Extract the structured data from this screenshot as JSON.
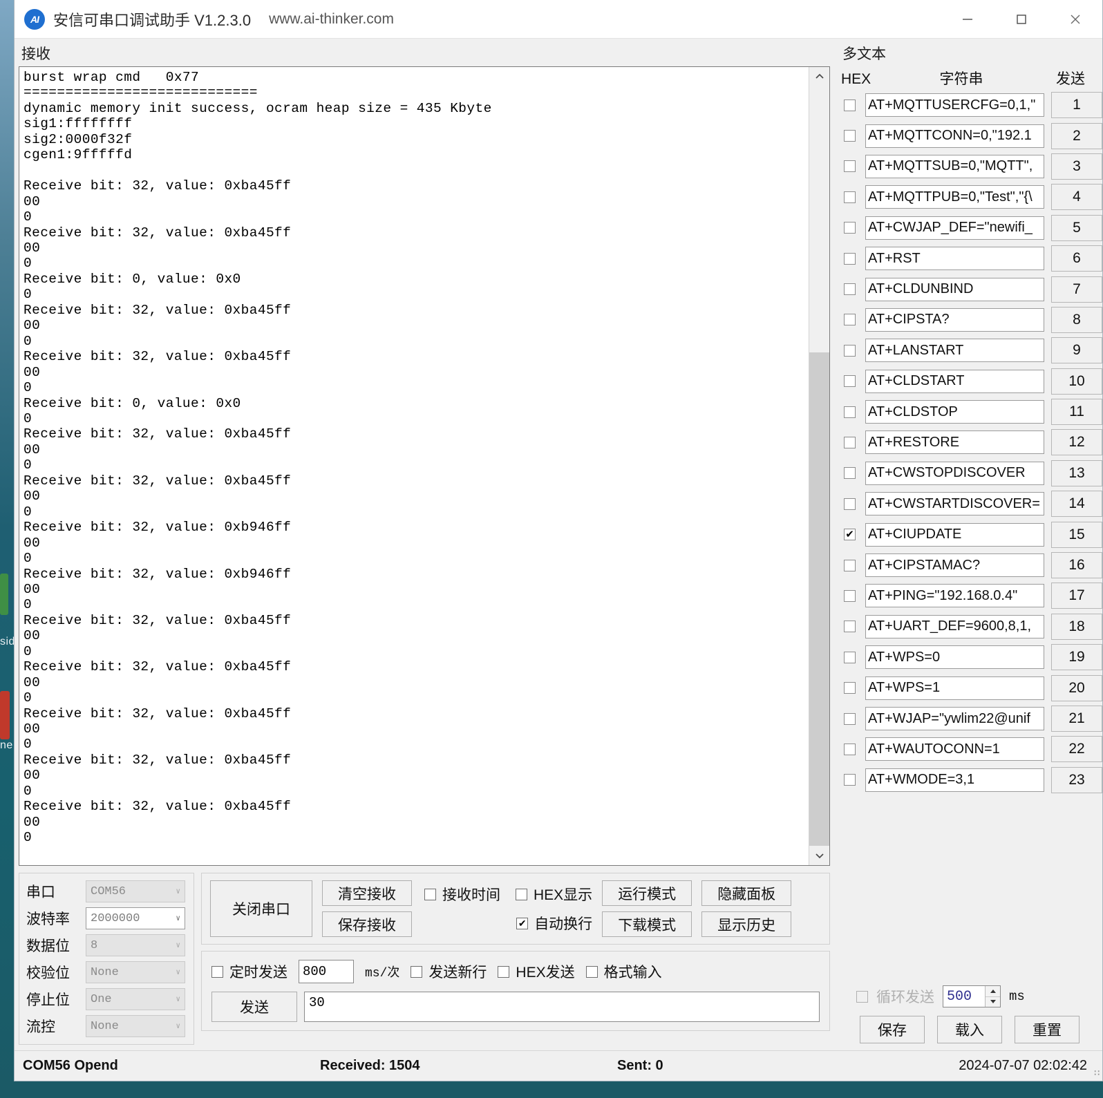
{
  "window": {
    "logo_text": "AI",
    "title": "安信可串口调试助手 V1.2.3.0",
    "url": "www.ai-thinker.com",
    "minimize": "—",
    "maximize": "☐",
    "close": "✕"
  },
  "receive": {
    "group_label": "接收",
    "text": "burst wrap cmd   0x77\n============================\ndynamic memory init success, ocram heap size = 435 Kbyte\nsig1:ffffffff\nsig2:0000f32f\ncgen1:9fffffd\n\nReceive bit: 32, value: 0xba45ff\n00\n0\nReceive bit: 32, value: 0xba45ff\n00\n0\nReceive bit: 0, value: 0x0\n0\nReceive bit: 32, value: 0xba45ff\n00\n0\nReceive bit: 32, value: 0xba45ff\n00\n0\nReceive bit: 0, value: 0x0\n0\nReceive bit: 32, value: 0xba45ff\n00\n0\nReceive bit: 32, value: 0xba45ff\n00\n0\nReceive bit: 32, value: 0xb946ff\n00\n0\nReceive bit: 32, value: 0xb946ff\n00\n0\nReceive bit: 32, value: 0xba45ff\n00\n0\nReceive bit: 32, value: 0xba45ff\n00\n0\nReceive bit: 32, value: 0xba45ff\n00\n0\nReceive bit: 32, value: 0xba45ff\n00\n0\nReceive bit: 32, value: 0xba45ff\n00\n0",
    "scroll_up": "▲",
    "scroll_down": "▼"
  },
  "serial_settings": {
    "rows": [
      {
        "label": "串口",
        "value": "COM56",
        "enabled": false
      },
      {
        "label": "波特率",
        "value": "2000000",
        "enabled": true
      },
      {
        "label": "数据位",
        "value": "8",
        "enabled": false
      },
      {
        "label": "校验位",
        "value": "None",
        "enabled": false
      },
      {
        "label": "停止位",
        "value": "One",
        "enabled": false
      },
      {
        "label": "流控",
        "value": "None",
        "enabled": false
      }
    ],
    "caret": "∨"
  },
  "controls": {
    "close_serial": "关闭串口",
    "clear_receive": "清空接收",
    "save_receive": "保存接收",
    "recv_time": {
      "label": "接收时间",
      "checked": false
    },
    "hex_display": {
      "label": "HEX显示",
      "checked": false
    },
    "auto_wrap": {
      "label": "自动换行",
      "checked": true
    },
    "run_mode": "运行模式",
    "download_mode": "下载模式",
    "hide_panel": "隐藏面板",
    "show_history": "显示历史",
    "check_mark": "✔"
  },
  "send_area": {
    "timed_send": {
      "label": "定时发送",
      "checked": false
    },
    "interval_value": "800",
    "interval_unit": "ms/次",
    "send_newline": {
      "label": "发送新行",
      "checked": false
    },
    "hex_send": {
      "label": "HEX发送",
      "checked": false
    },
    "format_input": {
      "label": "格式输入",
      "checked": false
    },
    "send_button": "发送",
    "send_text": "30"
  },
  "multitext": {
    "group_label": "多文本",
    "col_hex": "HEX",
    "col_string": "字符串",
    "col_send": "发送",
    "commands": [
      {
        "n": "1",
        "cmd": "AT+MQTTUSERCFG=0,1,\"",
        "checked": false
      },
      {
        "n": "2",
        "cmd": "AT+MQTTCONN=0,\"192.1",
        "checked": false
      },
      {
        "n": "3",
        "cmd": "AT+MQTTSUB=0,\"MQTT\",",
        "checked": false
      },
      {
        "n": "4",
        "cmd": "AT+MQTTPUB=0,\"Test\",\"{\\",
        "checked": false
      },
      {
        "n": "5",
        "cmd": "AT+CWJAP_DEF=\"newifi_",
        "checked": false
      },
      {
        "n": "6",
        "cmd": "AT+RST",
        "checked": false
      },
      {
        "n": "7",
        "cmd": "AT+CLDUNBIND",
        "checked": false
      },
      {
        "n": "8",
        "cmd": "AT+CIPSTA?",
        "checked": false
      },
      {
        "n": "9",
        "cmd": "AT+LANSTART",
        "checked": false
      },
      {
        "n": "10",
        "cmd": "AT+CLDSTART",
        "checked": false
      },
      {
        "n": "11",
        "cmd": "AT+CLDSTOP",
        "checked": false
      },
      {
        "n": "12",
        "cmd": "AT+RESTORE",
        "checked": false
      },
      {
        "n": "13",
        "cmd": "AT+CWSTOPDISCOVER",
        "checked": false
      },
      {
        "n": "14",
        "cmd": "AT+CWSTARTDISCOVER=",
        "checked": false
      },
      {
        "n": "15",
        "cmd": "AT+CIUPDATE",
        "checked": true
      },
      {
        "n": "16",
        "cmd": "AT+CIPSTAMAC?",
        "checked": false
      },
      {
        "n": "17",
        "cmd": "AT+PING=\"192.168.0.4\"",
        "checked": false
      },
      {
        "n": "18",
        "cmd": "AT+UART_DEF=9600,8,1,",
        "checked": false
      },
      {
        "n": "19",
        "cmd": "AT+WPS=0",
        "checked": false
      },
      {
        "n": "20",
        "cmd": "AT+WPS=1",
        "checked": false
      },
      {
        "n": "21",
        "cmd": "AT+WJAP=\"ywlim22@unif",
        "checked": false
      },
      {
        "n": "22",
        "cmd": "AT+WAUTOCONN=1",
        "checked": false
      },
      {
        "n": "23",
        "cmd": "AT+WMODE=3,1",
        "checked": false
      }
    ],
    "loop_send": {
      "label": "循环发送",
      "checked": false
    },
    "loop_value": "500",
    "loop_unit": "ms",
    "save": "保存",
    "load": "载入",
    "reset": "重置",
    "spin_up": "▲",
    "spin_down": "▼",
    "check_mark": "✔"
  },
  "statusbar": {
    "port_state": "COM56 Opend",
    "received": "Received: 1504",
    "sent": "Sent: 0",
    "timestamp": "2024-07-07 02:02:42",
    "grip": "∷"
  },
  "desktop": {
    "text_1": "sid",
    "text_2": "ne"
  },
  "colors": {
    "accent": "#0078d7",
    "window_bg": "#f0f0f0",
    "terminal_bg": "#ffffff"
  }
}
